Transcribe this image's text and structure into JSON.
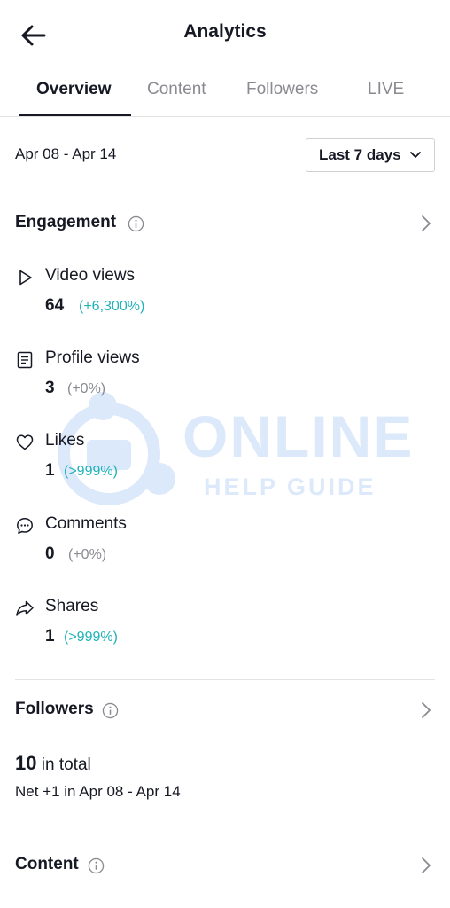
{
  "header": {
    "title": "Analytics"
  },
  "tabs": [
    {
      "label": "Overview",
      "active": true
    },
    {
      "label": "Content",
      "active": false
    },
    {
      "label": "Followers",
      "active": false
    },
    {
      "label": "LIVE",
      "active": false
    }
  ],
  "date": {
    "range": "Apr 08 - Apr 14",
    "period": "Last 7 days"
  },
  "engagement": {
    "title": "Engagement",
    "metrics": [
      {
        "icon": "play-icon",
        "label": "Video views",
        "value": "64",
        "change": "(+6,300%)",
        "trend": "up"
      },
      {
        "icon": "profile-doc-icon",
        "label": "Profile views",
        "value": "3",
        "change": "(+0%)",
        "trend": "flat"
      },
      {
        "icon": "heart-icon",
        "label": "Likes",
        "value": "1",
        "change": "(>999%)",
        "trend": "up"
      },
      {
        "icon": "comment-icon",
        "label": "Comments",
        "value": "0",
        "change": "(+0%)",
        "trend": "flat"
      },
      {
        "icon": "share-icon",
        "label": "Shares",
        "value": "1",
        "change": "(>999%)",
        "trend": "up"
      }
    ]
  },
  "followers": {
    "title": "Followers",
    "total_value": "10",
    "total_suffix": "in total",
    "net": "Net +1 in Apr 08 - Apr 14"
  },
  "content": {
    "title": "Content"
  },
  "watermark": {
    "line1": "ONLINE",
    "line2": "HELP GUIDE"
  },
  "colors": {
    "accent_up": "#20b2b8",
    "neutral": "#8a8b91",
    "text": "#161823"
  }
}
